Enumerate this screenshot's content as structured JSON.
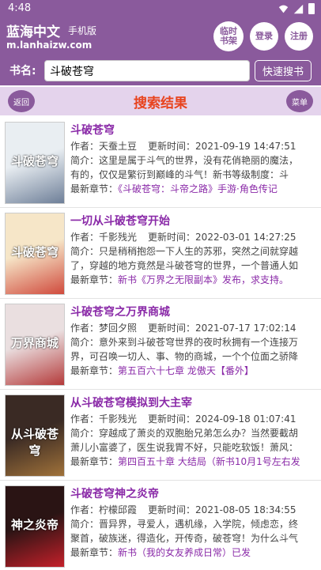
{
  "status": {
    "time": "4:48"
  },
  "header": {
    "site_name": "蓝海中文",
    "site_sub": "手机版",
    "site_url": "m.lanhaizw.com",
    "bookshelf_label": "临时\n书架",
    "login_label": "登录",
    "register_label": "注册"
  },
  "search": {
    "label": "书名:",
    "value": "斗破苍穹",
    "button_label": "快速搜书"
  },
  "titlebar": {
    "back_label": "返回",
    "title": "搜索结果",
    "menu_label": "菜单"
  },
  "results": [
    {
      "title": "斗破苍穹",
      "author_label": "作者：",
      "author": "天蚕土豆",
      "updated_label": "更新时间：",
      "updated": "2021-09-19 14:47:51",
      "intro_label": "简介：",
      "intro_1": "这里是属于斗气的世界，没有花俏艳丽的魔法，",
      "intro_2": "有的，仅仅是繁衍到巅峰的斗气！新书等级制度：斗",
      "latest_label": "最新章节：",
      "latest": "《斗破苍穹：斗帝之路》手游·角色传记",
      "cover_text": "斗破苍穹",
      "cover_color": "#e9eef2",
      "cover_color2": "#6e7f98"
    },
    {
      "title": "一切从斗破苍穹开始",
      "author_label": "作者：",
      "author": "千影残光",
      "updated_label": "更新时间：",
      "updated": "2022-03-01 14:27:25",
      "intro_label": "简介：",
      "intro_1": "只是稍稍抱怨一下人生的苏邪，突然之间就穿越",
      "intro_2": "了，穿越的地方竟然是斗破苍穹的世界，一个普通人如",
      "latest_label": "最新章节：",
      "latest": "新书《万界之无限副本》发布，求支持。",
      "cover_text": "斗破苍穹",
      "cover_color": "#f6e6c8",
      "cover_color2": "#d04a3c"
    },
    {
      "title": "斗破苍穹之万界商城",
      "author_label": "作者：",
      "author": "梦回夕照",
      "updated_label": "更新时间：",
      "updated": "2021-07-17 17:02:14",
      "intro_label": "简介：",
      "intro_1": "意外来到斗破苍穹世界的夜时秋拥有一个连接万",
      "intro_2": "界，可召唤一切人、事、物的商城，一个个位面之骄降",
      "latest_label": "最新章节：",
      "latest": "第五百六十七章 龙傲天【番外】",
      "cover_text": "万界商城",
      "cover_color": "#eadfe0",
      "cover_color2": "#b43a3a"
    },
    {
      "title": "从斗破苍穹模拟到大主宰",
      "author_label": "作者：",
      "author": "千影残光",
      "updated_label": "更新时间：",
      "updated": "2024-09-18 01:07:41",
      "intro_label": "简介：",
      "intro_1": "穿越成了萧炎的双胞胎兄弟怎么办？当然要截胡",
      "intro_2": "萧儿小富婆了，医生说我胃不好，只能吃软饭！萧风：",
      "latest_label": "最新章节：",
      "latest": "第四百五十章 大结局（新书10月1号左右发",
      "cover_text": "从斗破苍穹",
      "cover_color": "#3a2a24",
      "cover_color2": "#a0723a"
    },
    {
      "title": "斗破苍穹神之炎帝",
      "author_label": "作者：",
      "author": "柠檬邱霞",
      "updated_label": "更新时间：",
      "updated": "2021-08-05 18:34:55",
      "intro_label": "简介：",
      "intro_1": "晋异界，寻爱人，遇机缘，入学院，倾虑恋，终",
      "intro_2": "聚首，破族迷，得造化，开传奇，破苍穹！为什么斗气",
      "latest_label": "最新章节：",
      "latest": "新书（我的女友养成日常）已发",
      "cover_text": "神之炎帝",
      "cover_color": "#2a1414",
      "cover_color2": "#c4202a"
    }
  ]
}
